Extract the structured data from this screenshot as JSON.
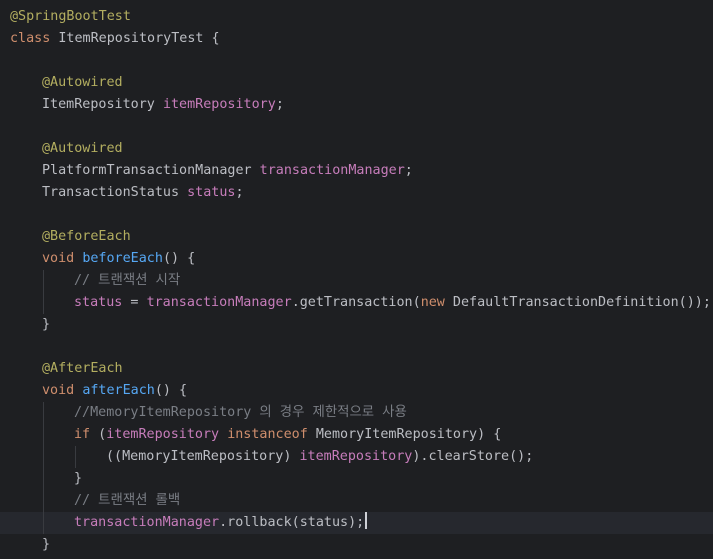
{
  "lines": [
    {
      "indent": 0,
      "guides": [],
      "tokens": [
        {
          "t": "@SpringBootTest",
          "c": "ann"
        }
      ]
    },
    {
      "indent": 0,
      "guides": [],
      "tokens": [
        {
          "t": "class",
          "c": "kw"
        },
        {
          "t": " ItemRepositoryTest {",
          "c": "pl"
        }
      ]
    },
    {
      "indent": 0,
      "guides": [],
      "tokens": []
    },
    {
      "indent": 1,
      "guides": [],
      "tokens": [
        {
          "t": "@Autowired",
          "c": "ann"
        }
      ]
    },
    {
      "indent": 1,
      "guides": [],
      "tokens": [
        {
          "t": "ItemRepository ",
          "c": "tp"
        },
        {
          "t": "itemRepository",
          "c": "fld"
        },
        {
          "t": ";",
          "c": "pl"
        }
      ]
    },
    {
      "indent": 0,
      "guides": [],
      "tokens": []
    },
    {
      "indent": 1,
      "guides": [],
      "tokens": [
        {
          "t": "@Autowired",
          "c": "ann"
        }
      ]
    },
    {
      "indent": 1,
      "guides": [],
      "tokens": [
        {
          "t": "PlatformTransactionManager ",
          "c": "tp"
        },
        {
          "t": "transactionManager",
          "c": "fld"
        },
        {
          "t": ";",
          "c": "pl"
        }
      ]
    },
    {
      "indent": 1,
      "guides": [],
      "tokens": [
        {
          "t": "TransactionStatus ",
          "c": "tp"
        },
        {
          "t": "status",
          "c": "fld"
        },
        {
          "t": ";",
          "c": "pl"
        }
      ]
    },
    {
      "indent": 0,
      "guides": [],
      "tokens": []
    },
    {
      "indent": 1,
      "guides": [],
      "tokens": [
        {
          "t": "@BeforeEach",
          "c": "ann"
        }
      ]
    },
    {
      "indent": 1,
      "guides": [],
      "tokens": [
        {
          "t": "void",
          "c": "kw"
        },
        {
          "t": " ",
          "c": "pl"
        },
        {
          "t": "beforeEach",
          "c": "fn"
        },
        {
          "t": "() {",
          "c": "pl"
        }
      ]
    },
    {
      "indent": 2,
      "guides": [
        1
      ],
      "tokens": [
        {
          "t": "// 트랜잭션 시작",
          "c": "cm"
        }
      ]
    },
    {
      "indent": 2,
      "guides": [
        1
      ],
      "tokens": [
        {
          "t": "status",
          "c": "fld"
        },
        {
          "t": " = ",
          "c": "pl"
        },
        {
          "t": "transactionManager",
          "c": "fld"
        },
        {
          "t": ".getTransaction(",
          "c": "pl"
        },
        {
          "t": "new",
          "c": "kw"
        },
        {
          "t": " DefaultTransactionDefinition());",
          "c": "pl"
        }
      ]
    },
    {
      "indent": 1,
      "guides": [],
      "tokens": [
        {
          "t": "}",
          "c": "pl"
        }
      ]
    },
    {
      "indent": 0,
      "guides": [],
      "tokens": []
    },
    {
      "indent": 1,
      "guides": [],
      "tokens": [
        {
          "t": "@AfterEach",
          "c": "ann"
        }
      ]
    },
    {
      "indent": 1,
      "guides": [],
      "tokens": [
        {
          "t": "void",
          "c": "kw"
        },
        {
          "t": " ",
          "c": "pl"
        },
        {
          "t": "afterEach",
          "c": "fn"
        },
        {
          "t": "() {",
          "c": "pl"
        }
      ]
    },
    {
      "indent": 2,
      "guides": [
        1
      ],
      "tokens": [
        {
          "t": "//MemoryItemRepository 의 경우 제한적으로 사용",
          "c": "cm"
        }
      ]
    },
    {
      "indent": 2,
      "guides": [
        1
      ],
      "tokens": [
        {
          "t": "if",
          "c": "kw"
        },
        {
          "t": " (",
          "c": "pl"
        },
        {
          "t": "itemRepository",
          "c": "fld"
        },
        {
          "t": " ",
          "c": "pl"
        },
        {
          "t": "instanceof",
          "c": "kw"
        },
        {
          "t": " MemoryItemRepository) {",
          "c": "pl"
        }
      ]
    },
    {
      "indent": 3,
      "guides": [
        1,
        2
      ],
      "tokens": [
        {
          "t": "((MemoryItemRepository) ",
          "c": "pl"
        },
        {
          "t": "itemRepository",
          "c": "fld"
        },
        {
          "t": ").clearStore();",
          "c": "pl"
        }
      ]
    },
    {
      "indent": 2,
      "guides": [
        1
      ],
      "tokens": [
        {
          "t": "}",
          "c": "pl"
        }
      ]
    },
    {
      "indent": 2,
      "guides": [
        1
      ],
      "tokens": [
        {
          "t": "// 트랜잭션 롤백",
          "c": "cm"
        }
      ]
    },
    {
      "indent": 2,
      "guides": [
        1
      ],
      "current": true,
      "caret": true,
      "tokens": [
        {
          "t": "transactionManager",
          "c": "fld"
        },
        {
          "t": ".rollback(status);",
          "c": "pl"
        }
      ]
    },
    {
      "indent": 1,
      "guides": [],
      "tokens": [
        {
          "t": "}",
          "c": "pl"
        }
      ]
    }
  ]
}
